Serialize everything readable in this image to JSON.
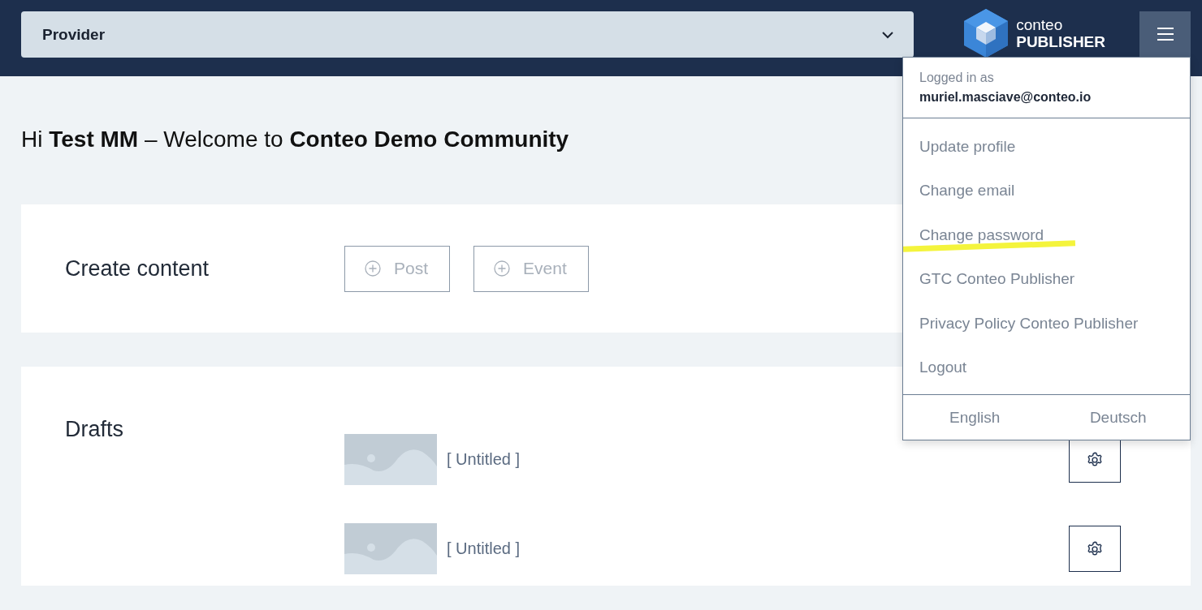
{
  "header": {
    "provider_select": {
      "value": "Provider"
    },
    "logo": {
      "line_1": "conteo",
      "line_2": "PUBLISHER"
    },
    "menu_open": true
  },
  "user_menu": {
    "logged_in_label": "Logged in as",
    "email": "muriel.masciave@conteo.io",
    "items": [
      {
        "label": "Update profile",
        "highlighted": false
      },
      {
        "label": "Change email",
        "highlighted": false
      },
      {
        "label": "Change password",
        "highlighted": true
      },
      {
        "label": "GTC Conteo Publisher",
        "highlighted": false
      },
      {
        "label": "Privacy Policy Conteo Publisher",
        "highlighted": false
      },
      {
        "label": "Logout",
        "highlighted": false
      }
    ],
    "languages": [
      "English",
      "Deutsch"
    ]
  },
  "greeting": "Hi **Test MM** – Welcome to **Conteo Demo Community**",
  "create_content": {
    "title": "Create content",
    "buttons": [
      "Post",
      "Event"
    ]
  },
  "drafts": {
    "title": "Drafts",
    "items": [
      {
        "title": "[ Untitled ]"
      },
      {
        "title": "[ Untitled ]"
      }
    ]
  }
}
